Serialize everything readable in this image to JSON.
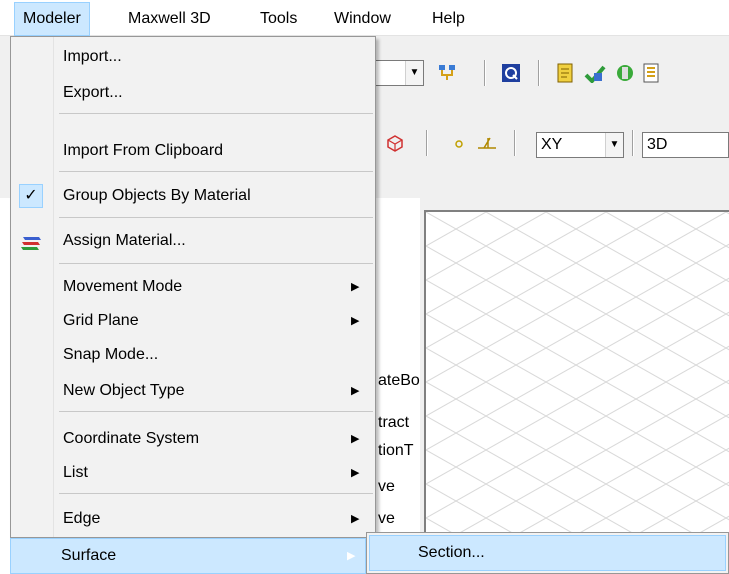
{
  "menubar": {
    "items": [
      "Modeler",
      "Maxwell 3D",
      "Tools",
      "Window",
      "Help"
    ]
  },
  "toolbar": {
    "plane_value": "XY",
    "view_value": "3D"
  },
  "tree_fragments": [
    "ateBo",
    "tract",
    "tionT",
    "ve",
    "ve"
  ],
  "modeler_menu": {
    "items": [
      {
        "label": "Import...",
        "mnemonic": "I"
      },
      {
        "label": "Export...",
        "mnemonic": "E"
      },
      {
        "label": "Import From Clipboard"
      },
      {
        "label": "Group Objects By Material",
        "checked": true
      },
      {
        "label": "Assign Material...",
        "icon": "material-stack-icon"
      },
      {
        "label": "Movement Mode",
        "submenu": true
      },
      {
        "label": "Grid Plane",
        "submenu": true
      },
      {
        "label": "Snap Mode..."
      },
      {
        "label": "New Object Type",
        "submenu": true
      },
      {
        "label": "Coordinate System",
        "submenu": true
      },
      {
        "label": "List",
        "submenu": true
      },
      {
        "label": "Edge",
        "submenu": true
      },
      {
        "label": "Surface",
        "submenu": true,
        "highlighted": true
      }
    ]
  },
  "surface_submenu": {
    "items": [
      {
        "label": "Section..."
      }
    ]
  },
  "colors": {
    "highlight": "#cce8ff",
    "highlight_border": "#99d1ff",
    "menu_bg": "#f2f2f2"
  }
}
